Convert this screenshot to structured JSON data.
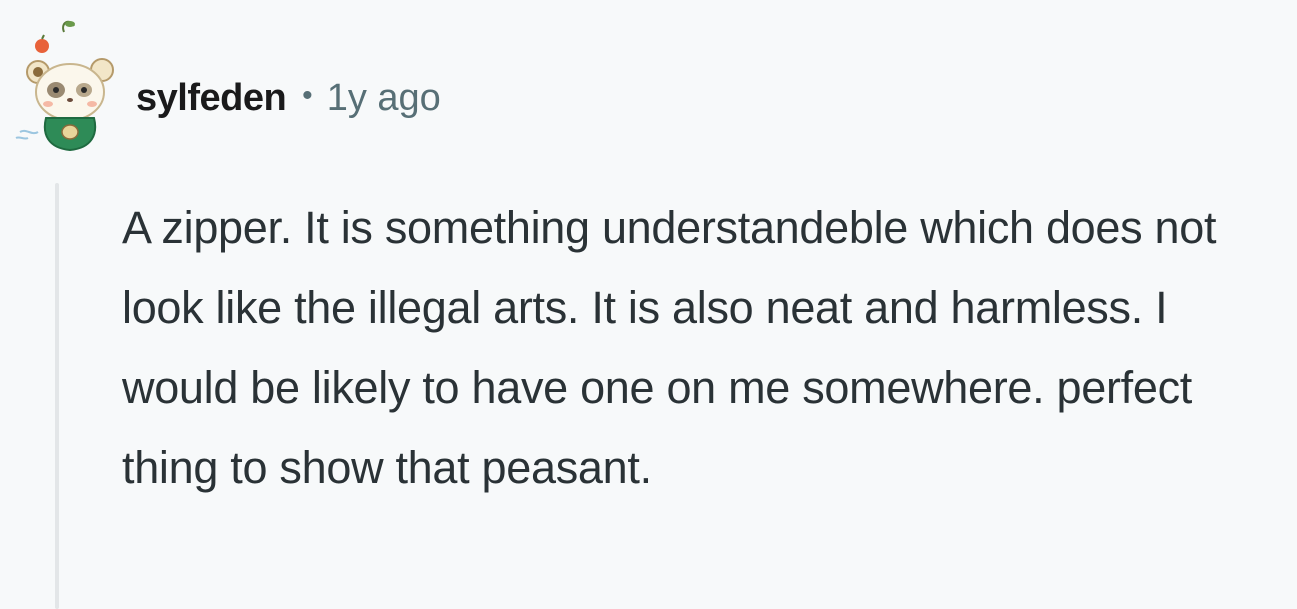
{
  "comment": {
    "username": "sylfeden",
    "separator": "•",
    "timestamp": "1y ago",
    "body": "A zipper. It is something understandeble which does not look like the illegal arts. It is also neat and harmless. I would be likely to have one on me somewhere. perfect thing to show that peasant.",
    "avatar_icon": "panda-avatar-icon"
  },
  "colors": {
    "background": "#f7f9fa",
    "username": "#1a1a1b",
    "meta": "#576f76",
    "body_text": "#2a3236",
    "thread_line": "#e3e6e8",
    "avatar_shirt": "#2e8b57"
  }
}
